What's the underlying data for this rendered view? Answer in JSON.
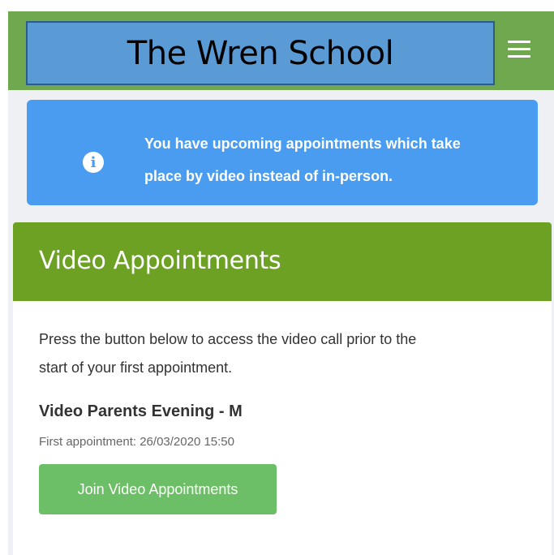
{
  "header": {
    "brand": "The Wren School",
    "menu_icon": "hamburger-menu-icon"
  },
  "alert": {
    "icon": "info-icon",
    "line1": "You have upcoming appointments which take",
    "line2": "place by video instead of in-person."
  },
  "card": {
    "title": "Video Appointments",
    "description_line1": "Press the button below to access the video call prior to the",
    "description_line2": "start of your first appointment.",
    "event_title": "Video Parents Evening - M",
    "event_subtitle": "First appointment: 26/03/2020 15:50",
    "join_label": "Join Video Appointments"
  },
  "colors": {
    "header_bg": "#6fa84e",
    "brand_box_bg": "#5b9bd5",
    "alert_bg": "#4a9cf0",
    "card_header_bg": "#6ca124",
    "join_button_bg": "#6dbf67",
    "content_bg": "#eef0f4"
  }
}
